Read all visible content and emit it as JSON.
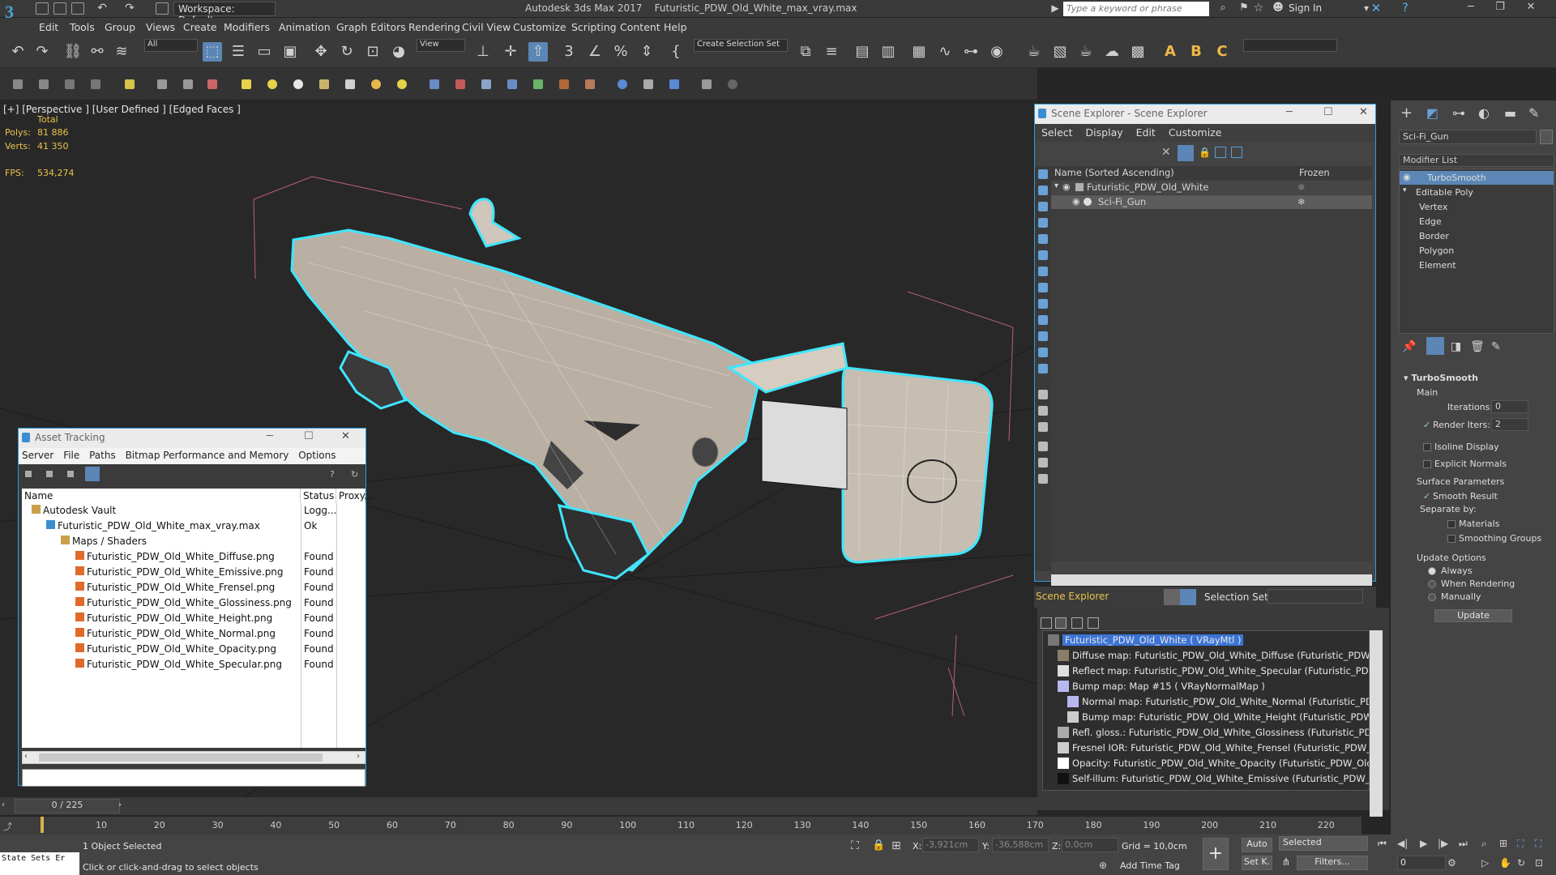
{
  "app": {
    "workspace_label": "Workspace: Default",
    "title_app": "Autodesk 3ds Max 2017",
    "title_file": "Futuristic_PDW_Old_White_max_vray.max",
    "search_placeholder": "Type a keyword or phrase",
    "sign_in": "Sign In"
  },
  "menus": [
    "Edit",
    "Tools",
    "Group",
    "Views",
    "Create",
    "Modifiers",
    "Animation",
    "Graph Editors",
    "Rendering",
    "Civil View",
    "Customize",
    "Scripting",
    "Content",
    "Help"
  ],
  "toolbar": {
    "selection_filter": "All",
    "reference_coord": "View",
    "create_selection_set": "Create Selection Set"
  },
  "viewport": {
    "label": "[+] [Perspective ]  [User Defined ]  [Edged Faces ]",
    "total_label": "Total",
    "polys_label": "Polys:",
    "polys_value": "81 886",
    "verts_label": "Verts:",
    "verts_value": "41 350",
    "fps_label": "FPS:",
    "fps_value": "534,274"
  },
  "asset_tracking": {
    "title": "Asset Tracking",
    "menu": [
      "Server",
      "File",
      "Paths",
      "Bitmap Performance and Memory",
      "Options"
    ],
    "columns": [
      "Name",
      "Status",
      "Proxy..."
    ],
    "rows": [
      {
        "name": "Autodesk Vault",
        "status": "Logg...",
        "indent": 0
      },
      {
        "name": "Futuristic_PDW_Old_White_max_vray.max",
        "status": "Ok",
        "indent": 1
      },
      {
        "name": "Maps / Shaders",
        "status": "",
        "indent": 2
      },
      {
        "name": "Futuristic_PDW_Old_White_Diffuse.png",
        "status": "Found",
        "indent": 3
      },
      {
        "name": "Futuristic_PDW_Old_White_Emissive.png",
        "status": "Found",
        "indent": 3
      },
      {
        "name": "Futuristic_PDW_Old_White_Frensel.png",
        "status": "Found",
        "indent": 3
      },
      {
        "name": "Futuristic_PDW_Old_White_Glossiness.png",
        "status": "Found",
        "indent": 3
      },
      {
        "name": "Futuristic_PDW_Old_White_Height.png",
        "status": "Found",
        "indent": 3
      },
      {
        "name": "Futuristic_PDW_Old_White_Normal.png",
        "status": "Found",
        "indent": 3
      },
      {
        "name": "Futuristic_PDW_Old_White_Opacity.png",
        "status": "Found",
        "indent": 3
      },
      {
        "name": "Futuristic_PDW_Old_White_Specular.png",
        "status": "Found",
        "indent": 3
      }
    ]
  },
  "scene_explorer": {
    "title": "Scene Explorer - Scene Explorer",
    "menu": [
      "Select",
      "Display",
      "Edit",
      "Customize"
    ],
    "col_name": "Name (Sorted Ascending)",
    "col_frozen": "Frozen",
    "items": [
      {
        "name": "Futuristic_PDW_Old_White",
        "selected": false
      },
      {
        "name": "Sci-Fi_Gun",
        "selected": true
      }
    ],
    "footer_label": "Scene Explorer",
    "selection_set_label": "Selection Set:"
  },
  "material_explorer": {
    "rows": [
      "Futuristic_PDW_Old_White  ( VRayMtl )",
      "Diffuse map: Futuristic_PDW_Old_White_Diffuse (Futuristic_PDW_Old_White_D",
      "Reflect map: Futuristic_PDW_Old_White_Specular (Futuristic_PDW_Old_White_",
      "Bump map: Map #15  ( VRayNormalMap )",
      "Normal map: Futuristic_PDW_Old_White_Normal (Futuristic_PDW_Old_White",
      "Bump map: Futuristic_PDW_Old_White_Height (Futuristic_PDW_Old_White_H",
      "Refl. gloss.: Futuristic_PDW_Old_White_Glossiness (Futuristic_PDW_Old_White",
      "Fresnel IOR: Futuristic_PDW_Old_White_Frensel (Futuristic_PDW_Old_White_F",
      "Opacity: Futuristic_PDW_Old_White_Opacity (Futuristic_PDW_Old_White_Opac",
      "Self-illum: Futuristic_PDW_Old_White_Emissive (Futuristic_PDW_Old_White_En"
    ]
  },
  "command_panel": {
    "object_name": "Sci-Fi_Gun",
    "modifier_list": "Modifier List",
    "stack": [
      "TurboSmooth",
      "Editable Poly",
      "Vertex",
      "Edge",
      "Border",
      "Polygon",
      "Element"
    ],
    "rollout_title": "TurboSmooth",
    "main_label": "Main",
    "iterations_label": "Iterations:",
    "iterations_value": "0",
    "render_iters_label": "Render Iters:",
    "render_iters_value": "2",
    "isoline_label": "Isoline Display",
    "explicit_normals_label": "Explicit Normals",
    "surface_params_label": "Surface Parameters",
    "smooth_result_label": "Smooth Result",
    "separate_by_label": "Separate by:",
    "materials_label": "Materials",
    "smoothing_groups_label": "Smoothing Groups",
    "update_options_label": "Update Options",
    "always_label": "Always",
    "when_rendering_label": "When Rendering",
    "manually_label": "Manually",
    "update_button": "Update"
  },
  "timeline": {
    "frame_display": "0 / 225",
    "ticks": [
      "10",
      "20",
      "30",
      "40",
      "50",
      "60",
      "70",
      "80",
      "90",
      "100",
      "110",
      "120",
      "130",
      "140",
      "150",
      "160",
      "170",
      "180",
      "190",
      "200",
      "210",
      "220"
    ]
  },
  "status": {
    "maxscript": "State Sets Er",
    "selected_text": "1 Object Selected",
    "prompt_text": "Click or click-and-drag to select objects",
    "x_label": "X:",
    "x_value": "-3,921cm",
    "y_label": "Y:",
    "y_value": "-36,588cm",
    "z_label": "Z:",
    "z_value": "0,0cm",
    "grid": "Grid = 10,0cm",
    "add_time_tag": "Add Time Tag",
    "auto_key": "Auto",
    "set_key": "Set K.",
    "selected_drop": "Selected",
    "filters": "Filters...",
    "frame_field": "0"
  },
  "colors": {
    "accent": "#5b86b5",
    "selection_outline": "#3fe6ff",
    "stat_yellow": "#e8c34a"
  }
}
